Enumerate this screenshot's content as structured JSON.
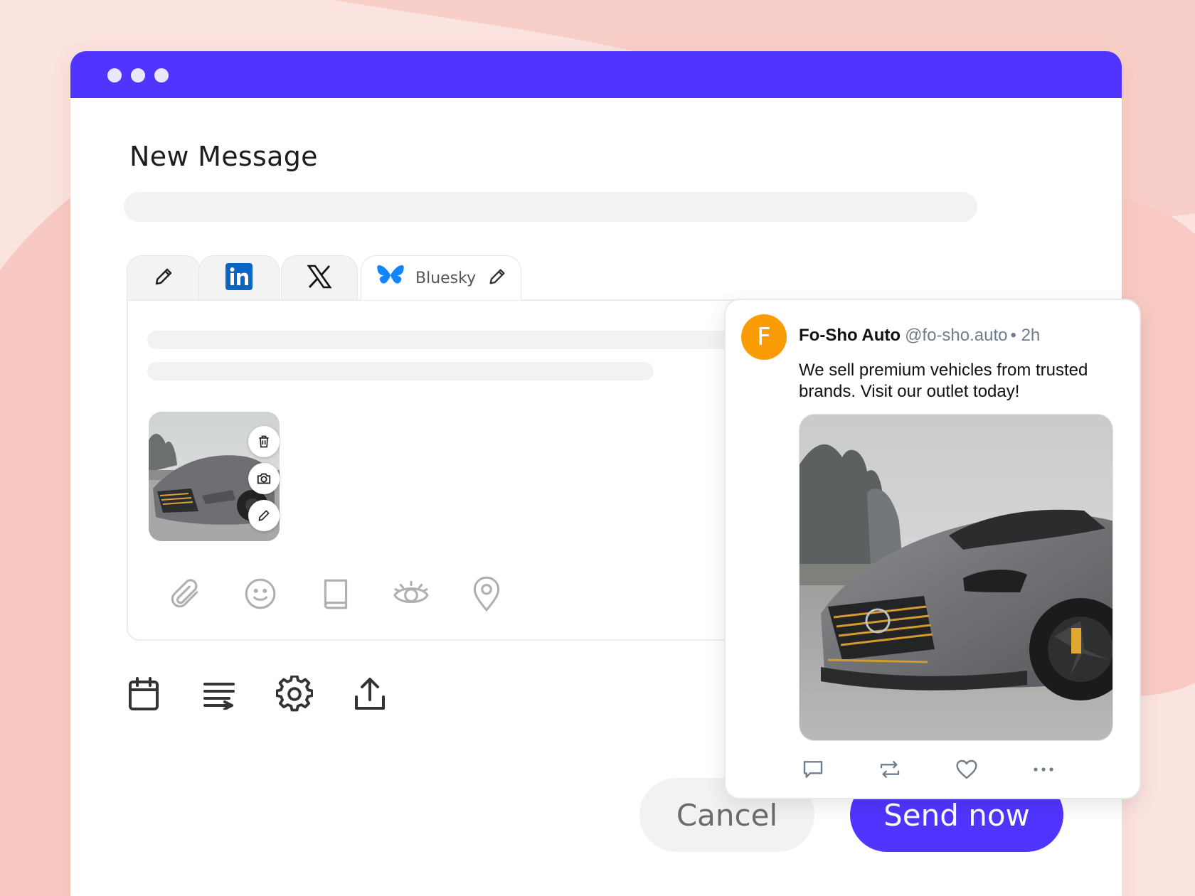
{
  "window": {
    "title": "New Message"
  },
  "tabs": [
    {
      "icon": "pencil-icon"
    },
    {
      "icon": "linkedin-icon"
    },
    {
      "icon": "x-logo-icon"
    },
    {
      "icon": "bluesky-butterfly-icon",
      "label": "Bluesky",
      "edit_icon": "pencil-icon"
    }
  ],
  "attachment": {
    "actions": [
      "trash-icon",
      "camera-icon",
      "pencil-icon"
    ]
  },
  "editor_tools": [
    "paperclip-icon",
    "smiley-icon",
    "book-icon",
    "eye-icon",
    "map-pin-icon"
  ],
  "bottom_tools": [
    "calendar-icon",
    "text-wrap-icon",
    "gear-icon",
    "upload-icon"
  ],
  "buttons": {
    "cancel": "Cancel",
    "send": "Send now"
  },
  "preview": {
    "avatar_letter": "F",
    "name": "Fo-Sho Auto",
    "handle": "@fo-sho.auto",
    "time": "• 2h",
    "text": "We sell premium vehicles from trusted brands. Visit our outlet today!",
    "actions": [
      "reply-icon",
      "repost-icon",
      "heart-icon",
      "more-icon"
    ]
  },
  "colors": {
    "accent": "#4f35ff",
    "avatar": "#f99c06",
    "background": "#fbe3df",
    "bluesky": "#1185fe",
    "linkedin": "#0a66c2"
  }
}
